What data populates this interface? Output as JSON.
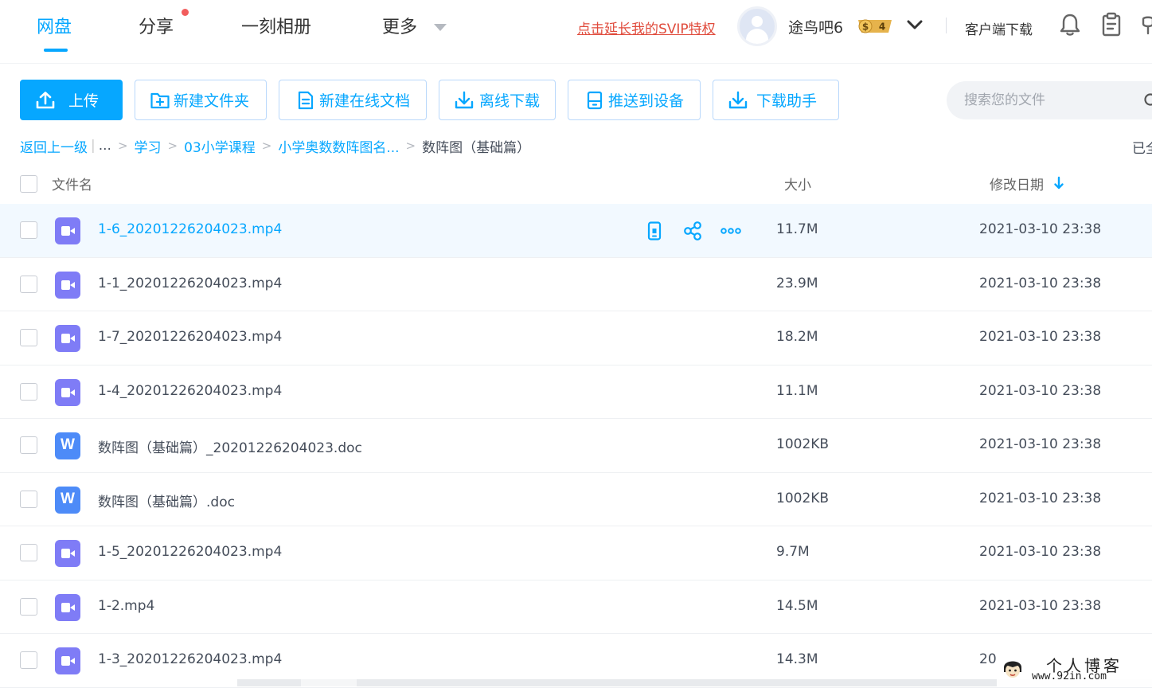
{
  "nav": {
    "tabs": [
      {
        "label": "网盘",
        "active": true
      },
      {
        "label": "分享",
        "has_dot": true
      },
      {
        "label": "一刻相册"
      },
      {
        "label": "更多"
      }
    ],
    "svip_link": "点击延长我的SVIP特权",
    "username": "途鸟吧6",
    "vip_badge_symbol": "$",
    "vip_level": "4",
    "client_download": "客户端下载"
  },
  "toolbar": {
    "upload": "上传",
    "new_folder": "新建文件夹",
    "new_online_doc": "新建在线文档",
    "offline_download": "离线下载",
    "push_to_device": "推送到设备",
    "download_helper": "下载助手",
    "search_placeholder": "搜索您的文件"
  },
  "breadcrumb": {
    "back": "返回上一级",
    "ellipsis": "...",
    "items": [
      "学习",
      "03小学课程",
      "小学奥数数阵图名..."
    ],
    "current": "数阵图（基础篇）",
    "loaded_all": "已全"
  },
  "table": {
    "col_name": "文件名",
    "col_size": "大小",
    "col_date": "修改日期",
    "rows": [
      {
        "name": "1-6_20201226204023.mp4",
        "size": "11.7M",
        "date": "2021-03-10 23:38",
        "type": "video",
        "hover": true
      },
      {
        "name": "1-1_20201226204023.mp4",
        "size": "23.9M",
        "date": "2021-03-10 23:38",
        "type": "video"
      },
      {
        "name": "1-7_20201226204023.mp4",
        "size": "18.2M",
        "date": "2021-03-10 23:38",
        "type": "video"
      },
      {
        "name": "1-4_20201226204023.mp4",
        "size": "11.1M",
        "date": "2021-03-10 23:38",
        "type": "video"
      },
      {
        "name": "数阵图（基础篇）_20201226204023.doc",
        "size": "1002KB",
        "date": "2021-03-10 23:38",
        "type": "doc"
      },
      {
        "name": "数阵图（基础篇）.doc",
        "size": "1002KB",
        "date": "2021-03-10 23:38",
        "type": "doc"
      },
      {
        "name": "1-5_20201226204023.mp4",
        "size": "9.7M",
        "date": "2021-03-10 23:38",
        "type": "video"
      },
      {
        "name": "1-2.mp4",
        "size": "14.5M",
        "date": "2021-03-10 23:38",
        "type": "video"
      },
      {
        "name": "1-3_20201226204023.mp4",
        "size": "14.3M",
        "date": "20",
        "type": "video"
      }
    ],
    "doc_icon_letter": "W"
  },
  "watermark": {
    "title": "个人博客",
    "url": "www.92in.com"
  },
  "colors": {
    "accent": "#06a7ff",
    "svip": "#e04b3c",
    "video_icon": "#7f7cf6",
    "doc_icon": "#4d8bf8",
    "hover_row": "#f2f9ff"
  },
  "icons": {
    "upload": "upload-icon",
    "new_folder": "folder-plus-icon",
    "new_doc": "document-icon",
    "offline": "download-icon",
    "push": "device-icon",
    "helper": "download-icon",
    "row_actions": [
      "phone-icon",
      "share-icon",
      "more-icon"
    ]
  }
}
